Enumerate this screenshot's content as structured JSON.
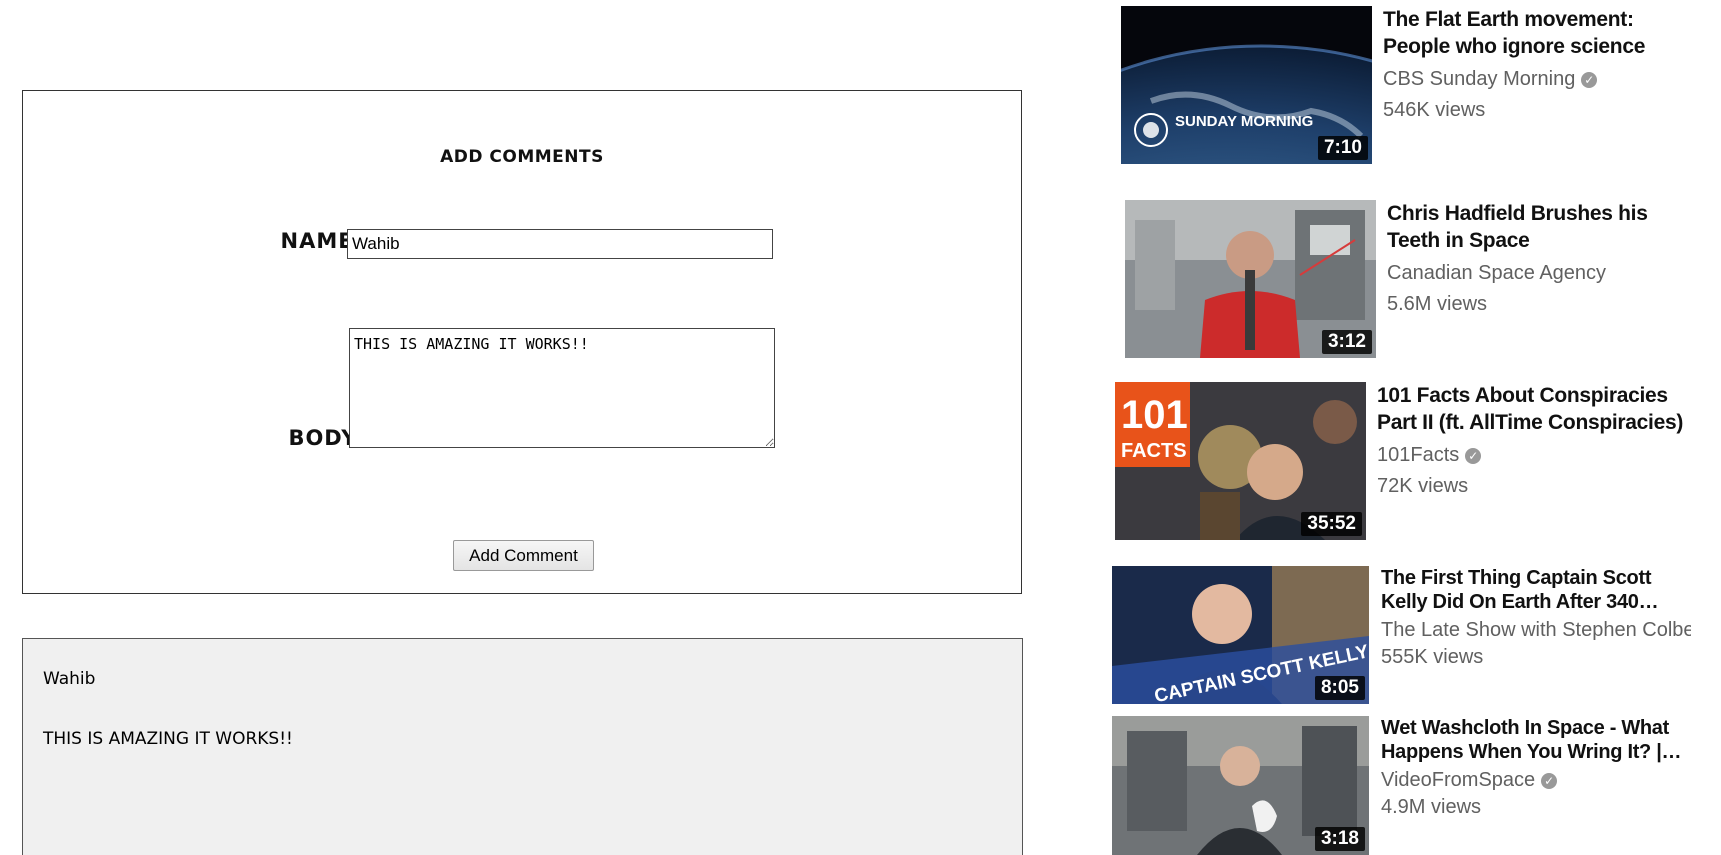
{
  "form": {
    "title": "Add Comments",
    "name_label": "Name:",
    "name_value": "Wahib",
    "body_label": "Body:",
    "body_value": "THIS IS AMAZING IT WORKS!!",
    "submit_label": "Add Comment"
  },
  "comment": {
    "author": "Wahib",
    "body": "THIS IS AMAZING IT WORKS!!"
  },
  "videos": [
    {
      "title": "The Flat Earth movement: People who ignore science",
      "channel": "CBS Sunday Morning",
      "verified": true,
      "views": "546K views",
      "duration": "7:10",
      "thumb_text": "SUNDAY MORNING"
    },
    {
      "title": "Chris Hadfield Brushes his Teeth in Space",
      "channel": "Canadian Space Agency",
      "verified": false,
      "views": "5.6M views",
      "duration": "3:12"
    },
    {
      "title": "101 Facts About Conspiracies Part II (ft. AllTime Conspiracies)",
      "channel": "101Facts",
      "verified": true,
      "views": "72K views",
      "duration": "35:52",
      "thumb_text_top": "101",
      "thumb_text_bottom": "FACTS"
    },
    {
      "title": "The First Thing Captain Scott Kelly Did On Earth After 340…",
      "channel": "The Late Show with Stephen Colbert",
      "verified": false,
      "views": "555K views",
      "duration": "8:05",
      "thumb_text": "CAPTAIN SCOTT KELLY"
    },
    {
      "title": "Wet Washcloth In Space - What Happens When You Wring It? |…",
      "channel": "VideoFromSpace",
      "verified": true,
      "views": "4.9M views",
      "duration": "3:18"
    }
  ],
  "icons": {
    "verified": "check-circle-icon"
  },
  "colors": {
    "comment_bg": "#f0f0f0",
    "meta_text": "#606060",
    "duration_bg": "#000000"
  }
}
